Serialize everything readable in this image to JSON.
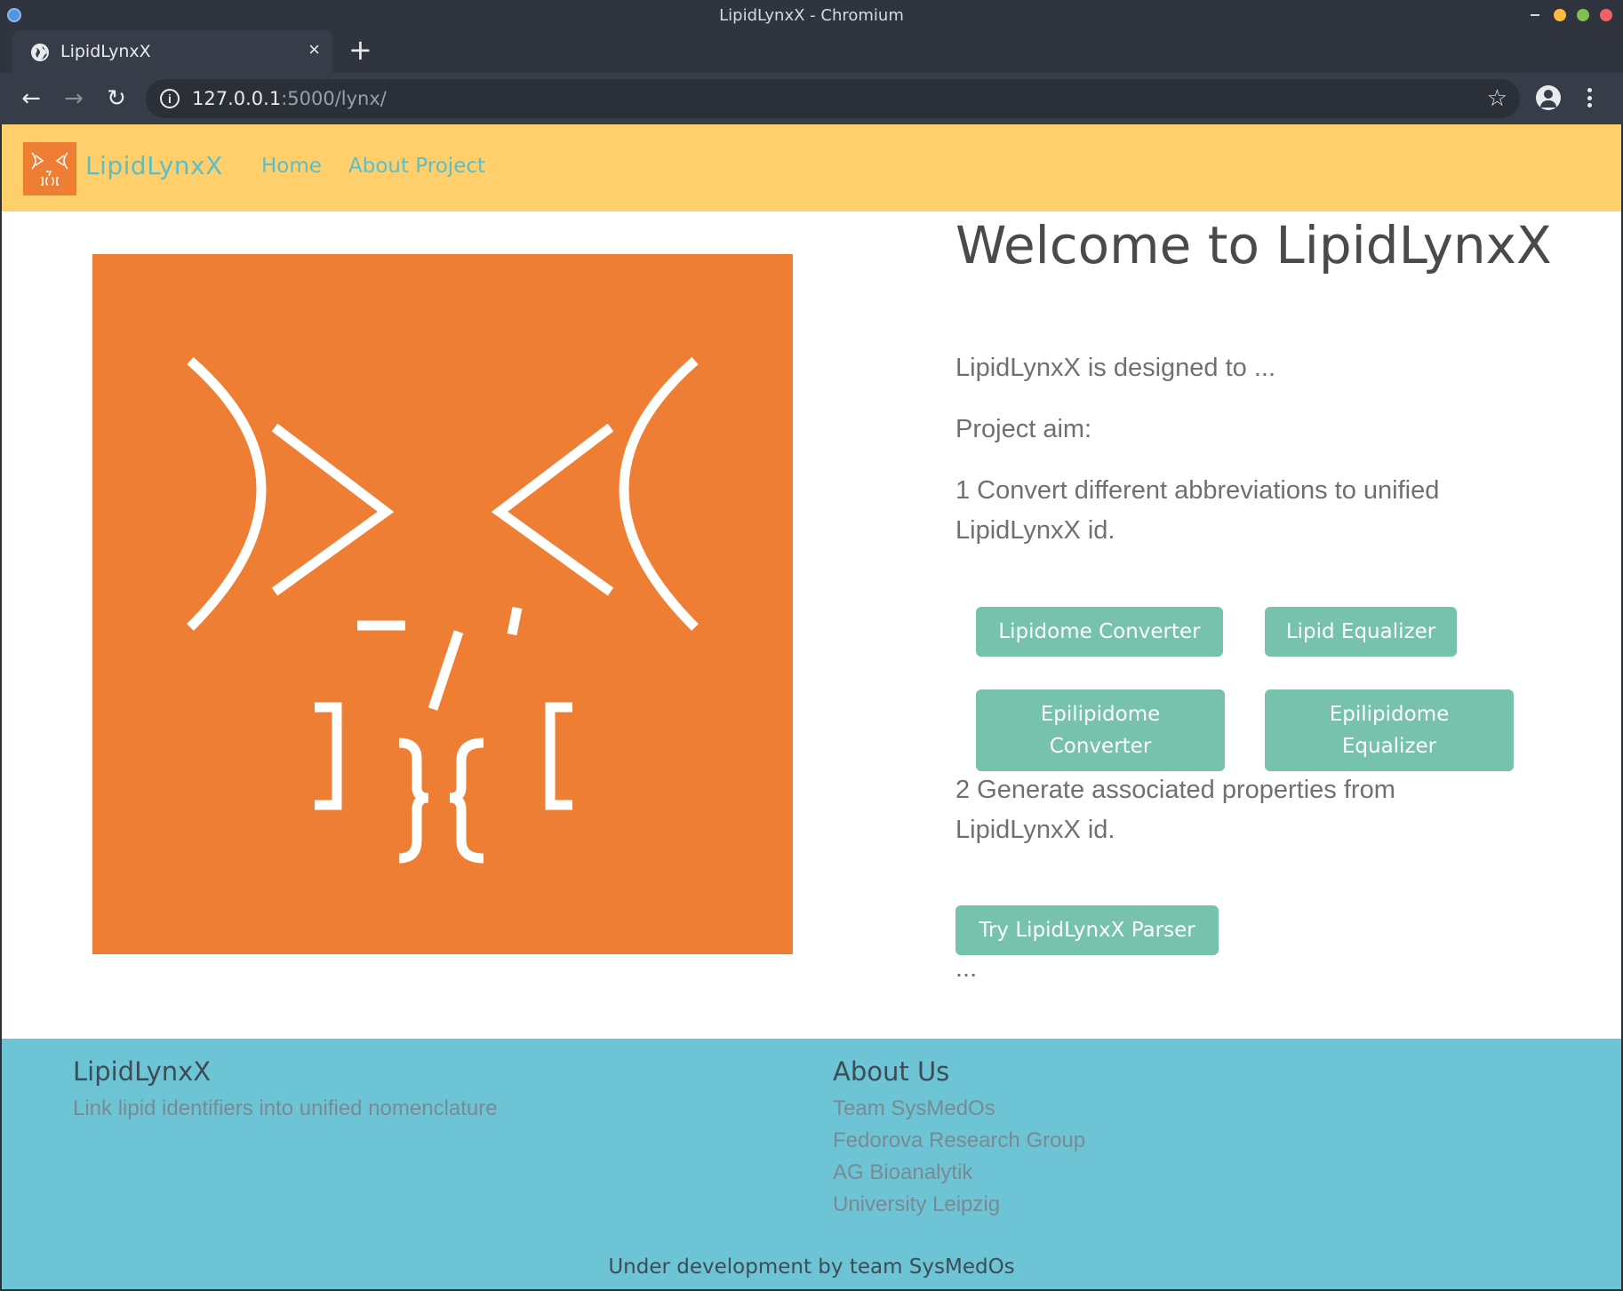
{
  "window": {
    "title": "LipidLynxX - Chromium"
  },
  "browser": {
    "tab_title": "LipidLynxX",
    "tab_close": "×",
    "new_tab": "+",
    "back": "←",
    "forward": "→",
    "reload": "↻",
    "url_host": "127.0.0.1",
    "url_rest": ":5000/lynx/",
    "star": "☆"
  },
  "navbar": {
    "brand": "LipidLynxX",
    "links": [
      "Home",
      "About Project"
    ]
  },
  "main": {
    "welcome": "Welcome to LipidLynxX",
    "intro": "LipidLynxX is designed to ...",
    "project_aim": "Project aim:",
    "aim1": "1 Convert different abbreviations to unified LipidLynxX id.",
    "buttons": [
      "Lipidome Converter",
      "Lipid Equalizer",
      "Epilipidome Converter",
      "Epilipidome Equalizer"
    ],
    "aim2": "2 Generate associated properties from LipidLynxX id.",
    "parser_button": "Try LipidLynxX Parser",
    "ellipsis": "..."
  },
  "footer": {
    "left_title": "LipidLynxX",
    "left_text": "Link lipid identifiers into unified nomenclature",
    "right_title": "About Us",
    "right_links": [
      "Team SysMedOs",
      "Fedorova Research Group",
      "AG Bioanalytik",
      "University Leipzig"
    ],
    "bottom": "Under development by team SysMedOs"
  },
  "colors": {
    "navbar_bg": "#ffcf6b",
    "brand_link": "#5bbfca",
    "logo_orange": "#ee7e33",
    "button_green": "#76c2ad",
    "footer_bg": "#6cc4d4"
  }
}
